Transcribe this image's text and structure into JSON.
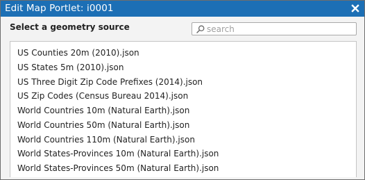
{
  "window": {
    "title": "Edit Map Portlet: i0001",
    "close_icon": "close-icon"
  },
  "colors": {
    "titlebar": "#1c6fb5",
    "panel": "#f3f3f3"
  },
  "geometry_source": {
    "label": "Select a geometry source",
    "search": {
      "placeholder": "search",
      "value": "",
      "icon": "search-icon"
    },
    "items": [
      "US Counties 20m (2010).json",
      "US States 5m (2010).json",
      "US Three Digit Zip Code Prefixes (2014).json",
      "US Zip Codes (Census Bureau 2014).json",
      "World Countries 10m (Natural Earth).json",
      "World Countries 50m (Natural Earth).json",
      "World Countries 110m (Natural Earth).json",
      "World States-Provinces 10m (Natural Earth).json",
      "World States-Provinces 50m (Natural Earth).json"
    ]
  }
}
